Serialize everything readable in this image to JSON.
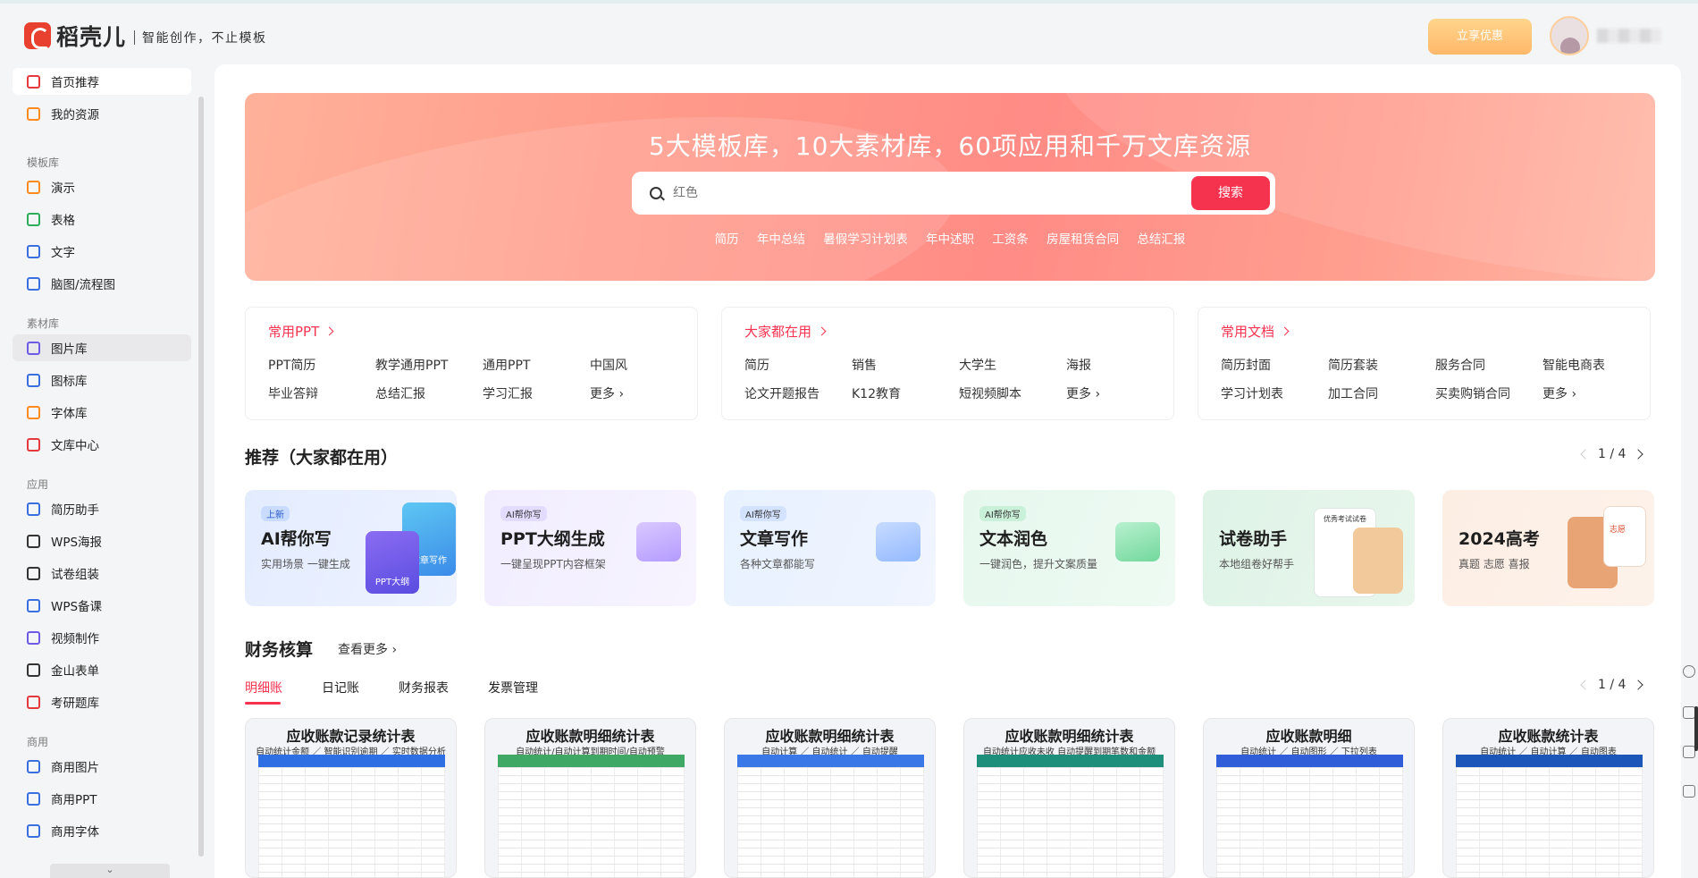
{
  "header": {
    "logo_text": "稻壳儿",
    "slogan": "智能创作，不止模板",
    "promo_label": "立享优惠"
  },
  "sidebar": {
    "top_items": [
      {
        "label": "首页推荐",
        "icon": "home-icon"
      },
      {
        "label": "我的资源",
        "icon": "folder-icon"
      }
    ],
    "groups": [
      {
        "title": "模板库",
        "items": [
          {
            "label": "演示",
            "icon": "presentation-icon"
          },
          {
            "label": "表格",
            "icon": "spreadsheet-icon"
          },
          {
            "label": "文字",
            "icon": "document-icon"
          },
          {
            "label": "脑图/流程图",
            "icon": "mindmap-icon"
          }
        ]
      },
      {
        "title": "素材库",
        "items": [
          {
            "label": "图片库",
            "icon": "image-icon"
          },
          {
            "label": "图标库",
            "icon": "icon-grid-icon"
          },
          {
            "label": "字体库",
            "icon": "font-icon"
          },
          {
            "label": "文库中心",
            "icon": "library-icon"
          }
        ]
      },
      {
        "title": "应用",
        "items": [
          {
            "label": "简历助手",
            "icon": "resume-icon"
          },
          {
            "label": "WPS海报",
            "icon": "poster-icon"
          },
          {
            "label": "试卷组装",
            "icon": "exam-icon"
          },
          {
            "label": "WPS备课",
            "icon": "lesson-icon"
          },
          {
            "label": "视频制作",
            "icon": "video-icon"
          },
          {
            "label": "金山表单",
            "icon": "form-icon"
          },
          {
            "label": "考研题库",
            "icon": "question-bank-icon"
          }
        ]
      },
      {
        "title": "商用",
        "items": [
          {
            "label": "商用图片",
            "icon": "commercial-image-icon"
          },
          {
            "label": "商用PPT",
            "icon": "commercial-ppt-icon"
          },
          {
            "label": "商用字体",
            "icon": "commercial-font-icon"
          }
        ]
      }
    ]
  },
  "banner": {
    "title": "5大模板库，10大素材库，60项应用和千万文库资源",
    "search_placeholder": "红色",
    "search_button": "搜索",
    "hotwords": [
      "简历",
      "年中总结",
      "暑假学习计划表",
      "年中述职",
      "工资条",
      "房屋租赁合同",
      "总结汇报"
    ]
  },
  "quick_cards": [
    {
      "title": "常用PPT",
      "links": [
        "PPT简历",
        "教学通用PPT",
        "通用PPT",
        "中国风",
        "毕业答辩",
        "总结汇报",
        "学习汇报",
        "更多 ›"
      ]
    },
    {
      "title": "大家都在用",
      "links": [
        "简历",
        "销售",
        "大学生",
        "海报",
        "论文开题报告",
        "K12教育",
        "短视频脚本",
        "更多 ›"
      ]
    },
    {
      "title": "常用文档",
      "links": [
        "简历封面",
        "简历套装",
        "服务合同",
        "智能电商表",
        "学习计划表",
        "加工合同",
        "买卖购销合同",
        "更多 ›"
      ]
    }
  ],
  "recommend": {
    "title": "推荐（大家都在用）",
    "pager": "1 / 4",
    "cards": [
      {
        "tag": "上新",
        "title": "AI帮你写",
        "sub": "实用场景  一键生成",
        "deco1": "文章写作",
        "deco2": "PPT大纲"
      },
      {
        "tag": "AI帮你写",
        "title": "PPT大纲生成",
        "sub": "一键呈现PPT内容框架"
      },
      {
        "tag": "AI帮你写",
        "title": "文章写作",
        "sub": "各种文章都能写"
      },
      {
        "tag": "AI帮你写",
        "title": "文本润色",
        "sub": "一键润色，提升文案质量"
      },
      {
        "tag": "",
        "title": "试卷助手",
        "sub": "本地组卷好帮手",
        "deco1": "优秀考试试卷"
      },
      {
        "tag": "",
        "title": "2024高考",
        "sub": "真题  志愿  喜报",
        "deco1": "志愿"
      }
    ]
  },
  "finance": {
    "title": "财务核算",
    "more": "查看更多 ›",
    "pager": "1 / 4",
    "tabs": [
      "明细账",
      "日记账",
      "财务报表",
      "发票管理"
    ],
    "templates": [
      {
        "title": "应收账款记录统计表",
        "sub": "自动统计金额  ／  智能识别逾期  ／  实时数据分析",
        "head_color": "#2f6fe4"
      },
      {
        "title": "应收账款明细统计表",
        "sub": "自动统计/自动计算到期时间/自动预警",
        "head_color": "#3ea864"
      },
      {
        "title": "应收账款明细统计表",
        "sub": "自动计算  ／  自动统计  ／  自动提醒",
        "head_color": "#3b78e7"
      },
      {
        "title": "应收账款明细统计表",
        "sub": "自动统计应收未收  自动提醒到期笔数和金额",
        "head_color": "#1e8f7a"
      },
      {
        "title": "应收账款明细",
        "sub": "自动统计  ／  自动图形  ／  下拉列表",
        "head_color": "#2f5ed8"
      },
      {
        "title": "应收账款统计表",
        "sub": "自动统计  ／  自动计算  ／  自动图表",
        "head_color": "#1b56b8"
      }
    ]
  }
}
